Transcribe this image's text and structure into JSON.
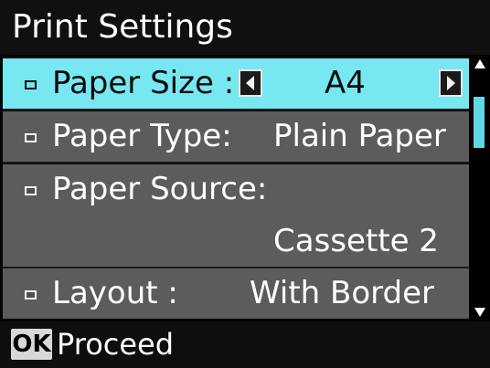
{
  "title": "Print Settings",
  "menu": {
    "items": [
      {
        "label": "Paper Size :",
        "value": "A4",
        "selected": true
      },
      {
        "label": "Paper Type:",
        "value": "Plain Paper",
        "selected": false
      },
      {
        "label": "Paper Source:",
        "value": "Cassette 2",
        "selected": false
      },
      {
        "label": "Layout :",
        "value": "With Border",
        "selected": false
      }
    ]
  },
  "footer": {
    "ok_label": "OK",
    "action_label": "Proceed"
  },
  "colors": {
    "highlight": "#77e8f2",
    "row_background": "#5c5c5c",
    "scroll_thumb": "#5fd8e6",
    "background": "#000000"
  },
  "icons": {
    "previous": "left-arrow-icon",
    "next": "right-arrow-icon",
    "scroll_up": "scroll-up-arrow-icon",
    "scroll_down": "scroll-down-arrow-icon",
    "bullet": "bullet-icon"
  }
}
